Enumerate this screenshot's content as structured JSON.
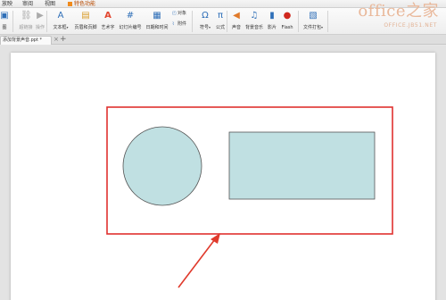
{
  "menu": {
    "items": [
      "放映",
      "审阅",
      "视图",
      "特色功能"
    ]
  },
  "ribbon": {
    "groups": [
      {
        "label": "图",
        "icon": "picture-icon"
      },
      {
        "label": "超链接",
        "icon": "hyperlink-icon"
      },
      {
        "label": "操作",
        "icon": "action-icon"
      },
      {
        "label": "文本框",
        "icon": "textbox-icon"
      },
      {
        "label": "页眉和页脚",
        "icon": "header-footer-icon"
      },
      {
        "label": "艺术字",
        "icon": "wordart-icon"
      },
      {
        "label": "幻灯片编号",
        "icon": "slide-number-icon"
      },
      {
        "label": "日期和时间",
        "icon": "date-time-icon"
      },
      {
        "label": "符号",
        "icon": "symbol-icon"
      },
      {
        "label": "公式",
        "icon": "formula-icon"
      },
      {
        "label": "声音",
        "icon": "sound-icon"
      },
      {
        "label": "背景音乐",
        "icon": "background-music-icon"
      },
      {
        "label": "影片",
        "icon": "movie-icon"
      },
      {
        "label": "Flash",
        "icon": "flash-icon"
      },
      {
        "label": "文件打包",
        "icon": "file-package-icon"
      }
    ],
    "small_buttons": [
      {
        "label": "对象",
        "icon": "object-icon"
      },
      {
        "label": "附件",
        "icon": "attachment-icon"
      }
    ]
  },
  "tabs": {
    "document_name": "添加背景声音.ppt *",
    "close_glyph": "×",
    "add_glyph": "+"
  },
  "watermark": {
    "title": "office之家",
    "subtitle": "OFFICE.JB51.NET"
  },
  "slide": {
    "shape_fill": "#c0e0e2",
    "shape_stroke": "#555555",
    "selection_color": "#e0312f",
    "arrow_color": "#e03a2c"
  }
}
